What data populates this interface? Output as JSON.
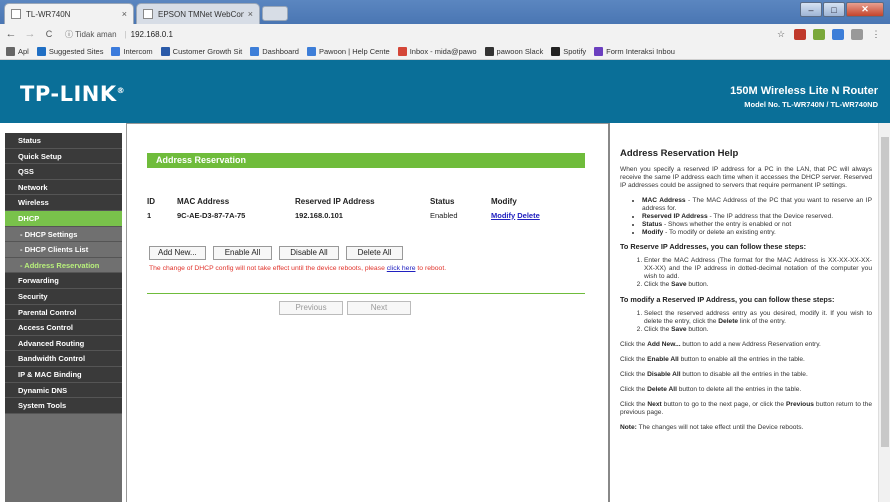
{
  "browser": {
    "tabs": [
      {
        "label": "TL-WR740N",
        "close": "×"
      },
      {
        "label": "EPSON TMNet WebConfi",
        "close": "×"
      }
    ],
    "window_buttons": {
      "minimize": "–",
      "maximize": "□",
      "close": "✕"
    },
    "nav": {
      "back": "←",
      "forward": "→",
      "reload": "C"
    },
    "omnibox": {
      "security": "ⓘ Tidak aman",
      "url": "192.168.0.1"
    },
    "bookmarks": [
      {
        "label": "Apl",
        "color": "#666666"
      },
      {
        "label": "Suggested Sites",
        "color": "#1f6fc4"
      },
      {
        "label": "Intercom",
        "color": "#3b7bdc"
      },
      {
        "label": "Customer Growth Sit",
        "color": "#2a5aa8"
      },
      {
        "label": "Dashboard",
        "color": "#3d7ed8"
      },
      {
        "label": "Pawoon | Help Cente",
        "color": "#3d7ed8"
      },
      {
        "label": "Inbox - mida@pawo",
        "color": "#d44638"
      },
      {
        "label": "pawoon Slack",
        "color": "#333333"
      },
      {
        "label": "Spotify",
        "color": "#222222"
      },
      {
        "label": "Form Interaksi Inbou",
        "color": "#6b3fbf"
      }
    ]
  },
  "banner": {
    "logo": "TP-LINK",
    "logo_mark": "®",
    "title": "150M Wireless Lite N Router",
    "model": "Model No. TL-WR740N / TL-WR740ND"
  },
  "sidebar": {
    "items": [
      {
        "label": "Status"
      },
      {
        "label": "Quick Setup"
      },
      {
        "label": "QSS"
      },
      {
        "label": "Network"
      },
      {
        "label": "Wireless"
      },
      {
        "label": "DHCP"
      },
      {
        "label": "- DHCP Settings"
      },
      {
        "label": "- DHCP Clients List"
      },
      {
        "label": "- Address Reservation"
      },
      {
        "label": "Forwarding"
      },
      {
        "label": "Security"
      },
      {
        "label": "Parental Control"
      },
      {
        "label": "Access Control"
      },
      {
        "label": "Advanced Routing"
      },
      {
        "label": "Bandwidth Control"
      },
      {
        "label": "IP & MAC Binding"
      },
      {
        "label": "Dynamic DNS"
      },
      {
        "label": "System Tools"
      }
    ]
  },
  "main": {
    "section_title": "Address Reservation",
    "columns": [
      "ID",
      "MAC Address",
      "Reserved IP Address",
      "Status",
      "Modify"
    ],
    "rows": [
      {
        "id": "1",
        "mac": "9C-AE-D3-87-7A-75",
        "ip": "192.168.0.101",
        "status": "Enabled",
        "modify": "Modify",
        "delete": "Delete"
      }
    ],
    "buttons": {
      "add": "Add New...",
      "enable_all": "Enable All",
      "disable_all": "Disable All",
      "delete_all": "Delete All"
    },
    "notice_before": "The change of DHCP config will not take effect until the device reboots, please ",
    "notice_link": "click here",
    "notice_after": " to reboot.",
    "pager": {
      "previous": "Previous",
      "next": "Next"
    }
  },
  "help": {
    "title": "Address Reservation Help",
    "intro": "When you specify a reserved IP address for a PC in the LAN, that PC will always receive the same IP address each time when it accesses the DHCP server. Reserved IP addresses could be assigned to servers that require permanent IP settings.",
    "bullets": [
      {
        "term": "MAC Address",
        "text": " - The MAC Address of the PC that you want to reserve an IP address for."
      },
      {
        "term": "Reserved IP Address",
        "text": " - The IP address that the Device reserved."
      },
      {
        "term": "Status",
        "text": " - Shows whether the entry is enabled or not"
      },
      {
        "term": "Modify",
        "text": " - To modify or delete an existing entry."
      }
    ],
    "reserve_heading": "To Reserve IP Addresses, you can follow these steps:",
    "reserve_steps": {
      "step1": "Enter the MAC Address (The format for the MAC Address is XX-XX-XX-XX-XX-XX) and the IP address in dotted-decimal notation of the computer you wish to add.",
      "step2_pre": "Click the ",
      "step2_bold": "Save",
      "step2_post": " button."
    },
    "modify_heading": "To modify a Reserved IP Address, you can follow these steps:",
    "modify_steps": {
      "step1_pre": "Select the reserved address entry as you desired, modify it. If you wish to delete the entry, click the ",
      "step1_bold": "Delete",
      "step1_post": " link of the entry.",
      "step2_pre": "Click the ",
      "step2_bold": "Save",
      "step2_post": " button."
    },
    "paragraphs": [
      {
        "pre": "Click the ",
        "bold": "Add New...",
        "post": " button to add a new Address Reservation entry."
      },
      {
        "pre": "Click the ",
        "bold": "Enable All",
        "post": " button to enable all the entries in the table."
      },
      {
        "pre": "Click the ",
        "bold": "Disable All",
        "post": " button to disable all the entries in the table."
      },
      {
        "pre": "Click the ",
        "bold": "Delete All",
        "post": " button to delete all the entries in the table."
      },
      {
        "pre": "Click the ",
        "bold": "Next",
        "post": " button to go to the next page, or click the ",
        "bold2": "Previous",
        "post2": " button return to the previous page."
      }
    ],
    "note_label": "Note:",
    "note_text": " The changes will not take effect until the Device reboots."
  }
}
